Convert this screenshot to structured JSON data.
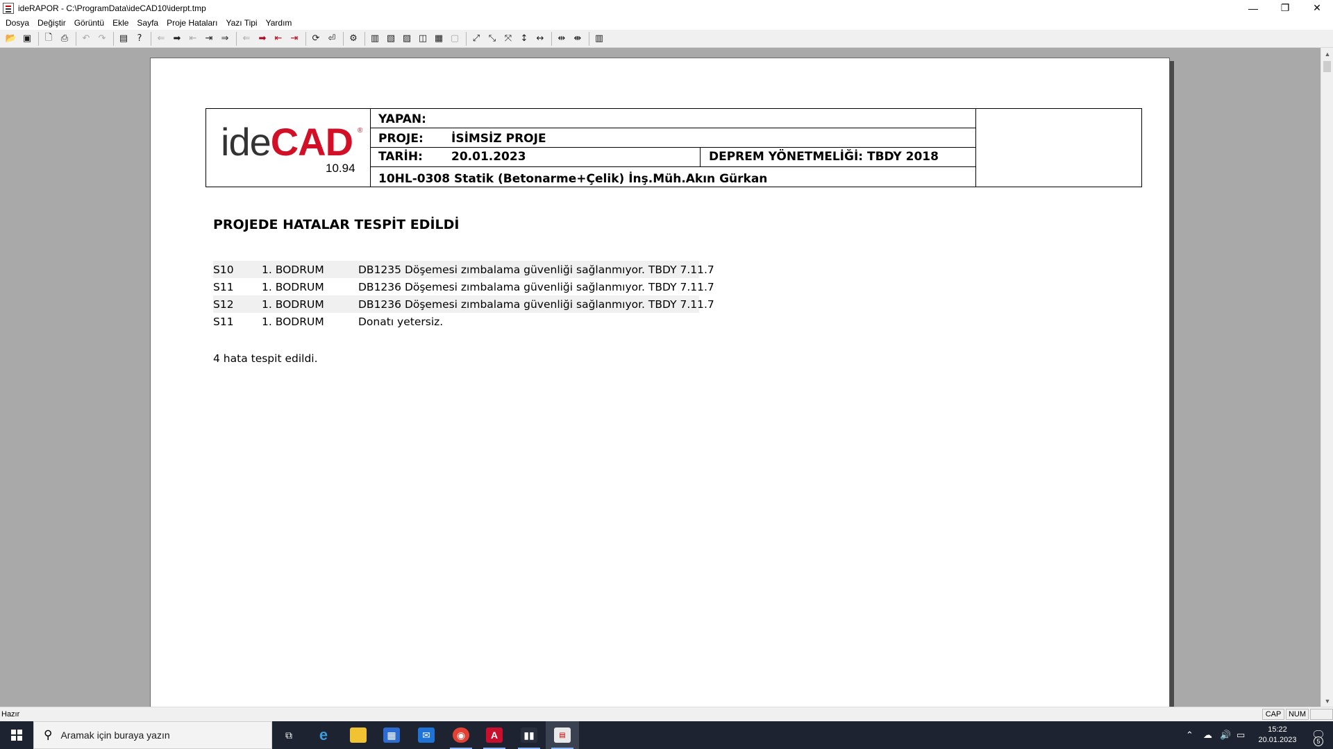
{
  "window": {
    "title": "ideRAPOR - C:\\ProgramData\\ideCAD10\\iderpt.tmp",
    "minimize": "—",
    "restore": "❐",
    "close": "✕"
  },
  "menu": [
    "Dosya",
    "Değiştir",
    "Görüntü",
    "Ekle",
    "Sayfa",
    "Proje Hataları",
    "Yazı Tipi",
    "Yardım"
  ],
  "toolbar": {
    "icons": [
      "open-icon",
      "save-icon",
      "print-preview-icon",
      "print-icon",
      "undo-icon",
      "redo-icon",
      "page-icon",
      "help-icon",
      "arrow-left-icon",
      "arrow-right-icon",
      "first-icon",
      "last-icon",
      "goto-icon",
      "prev-error-icon",
      "next-error-icon",
      "first-error-icon",
      "last-error-icon",
      "refresh-icon",
      "export-icon",
      "settings-icon",
      "layout-icons",
      "zoom-icons",
      "fit-icons"
    ]
  },
  "report": {
    "logo": {
      "ide": "ide",
      "cad": "CAD",
      "registered": "®",
      "version": "10.94"
    },
    "header": {
      "yapan_label": "YAPAN:",
      "yapan_value": "",
      "proje_label": "PROJE:",
      "proje_value": "İSİMSİZ PROJE",
      "tarih_label": "TARİH:",
      "tarih_value": "20.01.2023",
      "deprem": "DEPREM YÖNETMELİĞİ: TBDY 2018",
      "license": "10HL-0308 Statik (Betonarme+Çelik) İnş.Müh.Akın Gürkan"
    },
    "title": "PROJEDE HATALAR TESPİT EDİLDİ",
    "errors": [
      {
        "code": "S10",
        "floor": "1. BODRUM",
        "message": "DB1235 Döşemesi zımbalama güvenliği sağlanmıyor. TBDY 7.11.7"
      },
      {
        "code": "S11",
        "floor": "1. BODRUM",
        "message": "DB1236 Döşemesi zımbalama güvenliği sağlanmıyor. TBDY 7.11.7"
      },
      {
        "code": "S12",
        "floor": "1. BODRUM",
        "message": "DB1236 Döşemesi zımbalama güvenliği sağlanmıyor. TBDY 7.11.7"
      },
      {
        "code": "S11",
        "floor": "1. BODRUM",
        "message": "Donatı yetersiz."
      }
    ],
    "summary": "4 hata tespit edildi."
  },
  "statusbar": {
    "status": "Hazır",
    "cap": "CAP",
    "num": "NUM"
  },
  "taskbar": {
    "search_placeholder": "Aramak için buraya yazın",
    "time": "15:22",
    "date": "20.01.2023",
    "notification_count": "5"
  }
}
